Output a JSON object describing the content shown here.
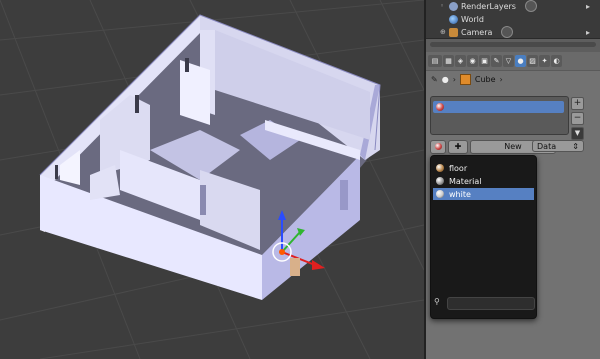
{
  "outliner": {
    "items": [
      {
        "label": "RenderLayers",
        "icon": "render-layers-icon"
      },
      {
        "label": "World",
        "icon": "world-icon"
      },
      {
        "label": "Camera",
        "icon": "camera-icon"
      }
    ]
  },
  "properties": {
    "breadcrumb": {
      "object": "Cube"
    },
    "material_slots": [
      ""
    ],
    "new_button": "New",
    "data_select": "Data",
    "add_slot_label": "+",
    "remove_slot_label": "−",
    "slot_menu_label": "▼"
  },
  "material_popup": {
    "items": [
      {
        "label": "floor",
        "selected": false
      },
      {
        "label": "Material",
        "selected": false
      },
      {
        "label": "white",
        "selected": true
      }
    ],
    "search_value": ""
  },
  "colors": {
    "accent": "#5680c2",
    "viewport_bg": "#3d3d3d",
    "walls": "#c9c9f0",
    "wall_top": "#9a9ad0"
  }
}
